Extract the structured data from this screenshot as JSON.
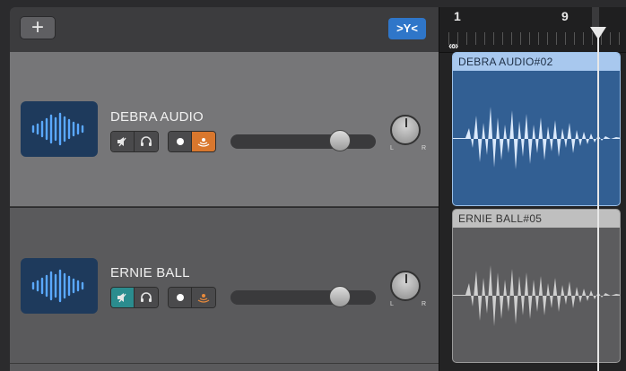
{
  "header": {
    "add_label": "+",
    "filter_label": ">Y<"
  },
  "tracks": [
    {
      "name": "DEBRA AUDIO",
      "mute_active": false,
      "listen_active": true,
      "volume_level": 0.75,
      "region_title": "DEBRA AUDIO#02"
    },
    {
      "name": "ERNIE BALL",
      "mute_active": true,
      "listen_active": true,
      "volume_level": 0.75,
      "region_title": "ERNIE BALL#05"
    }
  ],
  "ruler": {
    "bar_1": "1",
    "bar_9": "9",
    "cycle_glyph": "«»"
  },
  "pan_labels": {
    "left": "L",
    "right": "R"
  },
  "colors": {
    "accent_blue": "#2f76c9",
    "mute_teal": "#2b8c8e",
    "listen_orange": "#d9772d",
    "region_blue": "#325f93"
  }
}
